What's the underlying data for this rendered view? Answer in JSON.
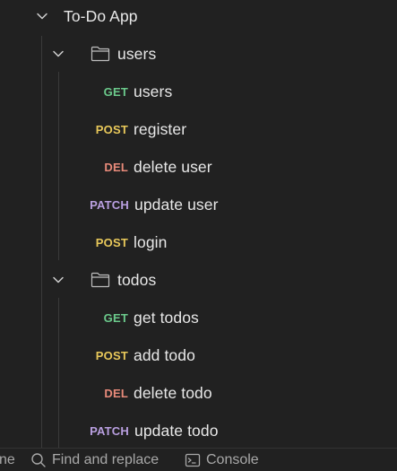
{
  "colors": {
    "background": "#212121",
    "text": "#e8e8e8",
    "muted": "#a8a8a8",
    "GET": "#6bc98b",
    "POST": "#e8c85a",
    "DEL": "#e88a7a",
    "PATCH": "#b99fe0"
  },
  "collection": {
    "name": "To-Do App",
    "expanded": true,
    "chevron_icon": "chevron-down-icon"
  },
  "folders": [
    {
      "name": "users",
      "icon": "folder-icon",
      "requests": [
        {
          "method": "GET",
          "name": "users"
        },
        {
          "method": "POST",
          "name": "register"
        },
        {
          "method": "DEL",
          "name": "delete user"
        },
        {
          "method": "PATCH",
          "name": "update user"
        },
        {
          "method": "POST",
          "name": "login"
        }
      ]
    },
    {
      "name": "todos",
      "icon": "folder-icon",
      "requests": [
        {
          "method": "GET",
          "name": "get todos"
        },
        {
          "method": "POST",
          "name": "add todo"
        },
        {
          "method": "DEL",
          "name": "delete todo"
        },
        {
          "method": "PATCH",
          "name": "update todo"
        }
      ]
    }
  ],
  "statusbar": {
    "partial_left": "ne",
    "find_replace": "Find and replace",
    "console": "Console"
  }
}
